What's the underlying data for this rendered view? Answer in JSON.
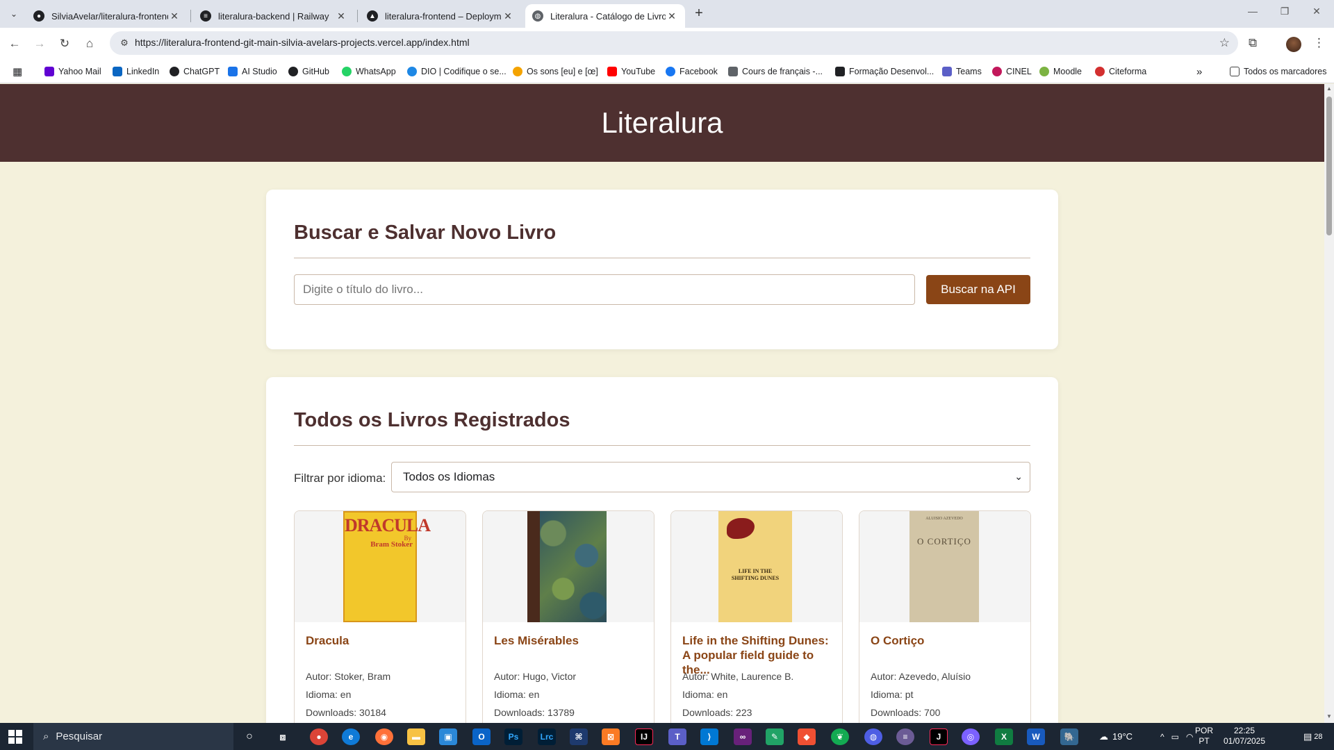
{
  "browser": {
    "tabs": [
      {
        "title": "SilviaAvelar/literalura-frontend",
        "icon": "github-icon"
      },
      {
        "title": "literalura-backend | Railway",
        "icon": "railway-icon"
      },
      {
        "title": "literalura-frontend – Deployment",
        "icon": "vercel-icon"
      },
      {
        "title": "Literalura - Catálogo de Livros",
        "icon": "globe-icon",
        "active": true
      }
    ],
    "url": "https://literalura-frontend-git-main-silvia-avelars-projects.vercel.app/index.html",
    "bookmarks": [
      {
        "label": "Yahoo Mail",
        "color": "#6001d2"
      },
      {
        "label": "LinkedIn",
        "color": "#0a66c2"
      },
      {
        "label": "ChatGPT",
        "color": "#202124"
      },
      {
        "label": "AI Studio",
        "color": "#1a73e8"
      },
      {
        "label": "GitHub",
        "color": "#202124"
      },
      {
        "label": "WhatsApp",
        "color": "#25d366"
      },
      {
        "label": "DIO | Codifique o se...",
        "color": "#1e88e5"
      },
      {
        "label": "Os sons [eu] e [œ]",
        "color": "#f4a300"
      },
      {
        "label": "YouTube",
        "color": "#ff0000"
      },
      {
        "label": "Facebook",
        "color": "#1877f2"
      },
      {
        "label": "Cours de français -...",
        "color": "#5f6368"
      },
      {
        "label": "Formação Desenvol...",
        "color": "#202124"
      },
      {
        "label": "Teams",
        "color": "#5b5fc7"
      },
      {
        "label": "CINEL",
        "color": "#c2185b"
      },
      {
        "label": "Moodle",
        "color": "#7cb342"
      },
      {
        "label": "Citeforma",
        "color": "#d32f2f"
      }
    ],
    "all_bookmarks": "Todos os marcadores"
  },
  "site": {
    "title": "Literalura",
    "search_section": {
      "heading": "Buscar e Salvar Novo Livro",
      "placeholder": "Digite o título do livro...",
      "button": "Buscar na API"
    },
    "books_section": {
      "heading": "Todos os Livros Registrados",
      "filter_label": "Filtrar por idioma:",
      "filter_value": "Todos os Idiomas"
    },
    "books": [
      {
        "title": "Dracula",
        "author": "Autor: Stoker, Bram",
        "language": "Idioma: en",
        "downloads": "Downloads: 30184",
        "cover_title": "DRACULA",
        "cover_sub": "By",
        "cover_author": "Bram Stoker"
      },
      {
        "title": "Les Misérables",
        "author": "Autor: Hugo, Victor",
        "language": "Idioma: en",
        "downloads": "Downloads: 13789"
      },
      {
        "title": "Life in the Shifting Dunes: A popular field guide to the...",
        "author": "Autor: White, Laurence B.",
        "language": "Idioma: en",
        "downloads": "Downloads: 223",
        "cover_title": "LIFE IN THE SHIFTING DUNES"
      },
      {
        "title": "O Cortiço",
        "author": "Autor: Azevedo, Aluísio",
        "language": "Idioma: pt",
        "downloads": "Downloads: 700",
        "cover_author": "ALUISIO AZEVEDO",
        "cover_title": "O CORTIÇO"
      }
    ]
  },
  "taskbar": {
    "search_placeholder": "Pesquisar",
    "weather": "19°C",
    "lang_top": "POR",
    "lang_bottom": "PT",
    "time": "22:25",
    "date": "01/07/2025",
    "notifications": "28"
  }
}
